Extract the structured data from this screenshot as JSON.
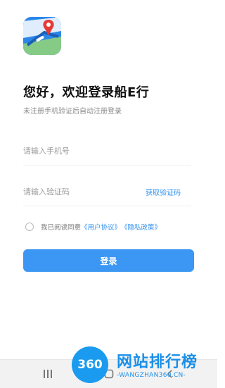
{
  "header": {
    "greeting": "您好，欢迎登录船E行",
    "subtitle": "未注册手机验证后自动注册登录"
  },
  "form": {
    "phone_placeholder": "请输入手机号",
    "code_placeholder": "请输入验证码",
    "get_code_label": "获取验证码"
  },
  "agreement": {
    "prefix": "我已阅读同意",
    "user_agreement": "《用户协议》",
    "privacy_policy": "《隐私政策》"
  },
  "login_button_label": "登录",
  "watermark": {
    "badge": "360",
    "title": "网站排行榜",
    "domain": "-WANGZHAN360.CN-"
  },
  "colors": {
    "accent": "#3b97f3",
    "link": "#2f8ff0"
  }
}
